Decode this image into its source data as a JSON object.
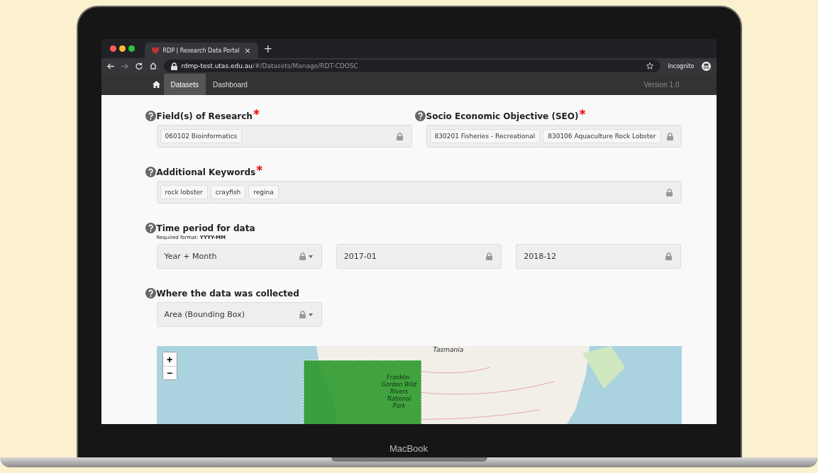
{
  "browser": {
    "tab_title": "RDP | Research Data Portal",
    "tab_close": "×",
    "new_tab": "+",
    "url_host": "rdmp-test.utas.edu.au",
    "url_path": "/#/Datasets/Manage/RDT-CDOSC",
    "profile": "Incognito"
  },
  "navbar": {
    "items": [
      {
        "label": "Datasets",
        "selected": true
      },
      {
        "label": "Dashboard",
        "selected": false
      }
    ],
    "version": "Version 1.0"
  },
  "sections": [
    {
      "columns": [
        {
          "label": "Field(s) of Research",
          "required_mark": "*",
          "fields": [
            {
              "kind": "tags",
              "tags": [
                "060102 Bioinformatics"
              ],
              "locked": true
            }
          ]
        },
        {
          "label": "Socio Economic Objective (SEO)",
          "required_mark": "*",
          "fields": [
            {
              "kind": "tags",
              "tags": [
                "830201 Fisheries - Recreational",
                "830106 Aquaculture Rock Lobster"
              ],
              "locked": true
            }
          ]
        }
      ]
    },
    {
      "columns": [
        {
          "label": "Additional Keywords",
          "required_mark": "*",
          "fields": [
            {
              "kind": "tags",
              "tags": [
                "rock lobster",
                "crayfish",
                "regina"
              ],
              "locked": true
            }
          ]
        }
      ]
    },
    {
      "columns": [
        {
          "label": "Time period for data",
          "hint": "Required format: **YYYY-MM**",
          "fields": [
            {
              "kind": "select",
              "value": "Year + Month",
              "locked": true
            },
            {
              "kind": "text",
              "value": "2017-01",
              "locked": true
            },
            {
              "kind": "text",
              "value": "2018-12",
              "locked": true
            }
          ]
        }
      ]
    },
    {
      "columns": [
        {
          "label": "Where the data was collected",
          "fields": [
            {
              "kind": "select",
              "value": "Area (Bounding Box)",
              "locked": true
            }
          ]
        }
      ]
    }
  ],
  "map": {
    "zoom_in": "+",
    "zoom_out": "−",
    "labels": [
      "Tasmania",
      "Franklin-Gordon Wild Rivers National Park"
    ]
  },
  "laptop": {
    "brand": "MacBook"
  }
}
